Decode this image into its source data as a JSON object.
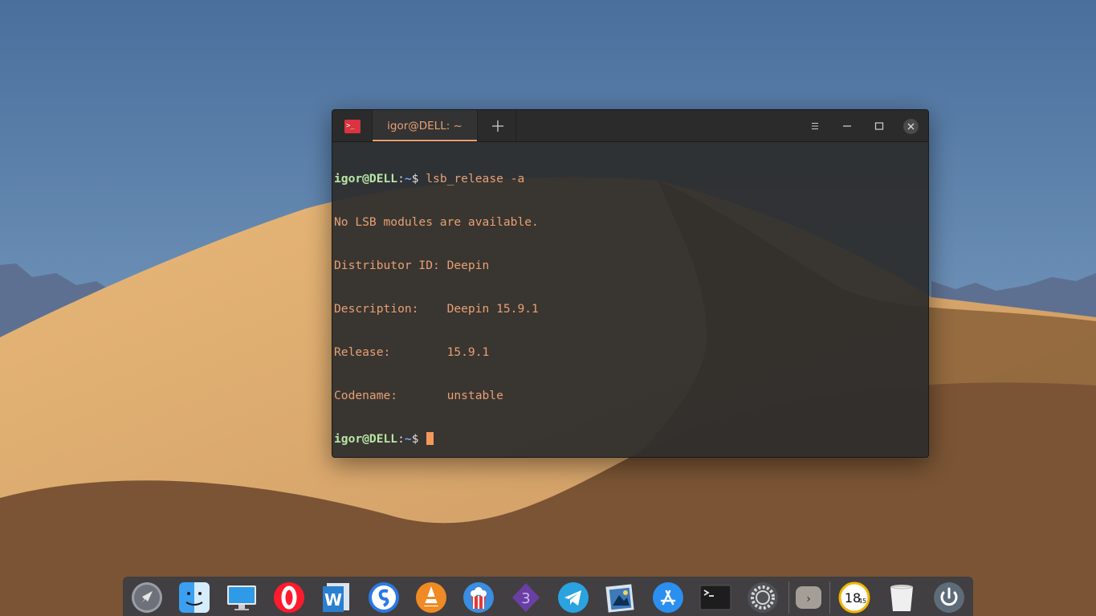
{
  "window": {
    "tab_title": "igor@DELL: ~",
    "app_icon_glyph": ">_"
  },
  "terminal": {
    "prompt": {
      "user": "igor@DELL",
      "colon": ":",
      "dir": "~",
      "dollar": "$"
    },
    "command": " lsb_release -a",
    "output": [
      "No LSB modules are available.",
      "Distributor ID: Deepin",
      "Description:    Deepin 15.9.1",
      "Release:        15.9.1",
      "Codename:       unstable"
    ]
  },
  "dock": {
    "items": [
      {
        "name": "launcher-icon"
      },
      {
        "name": "finder-icon"
      },
      {
        "name": "desktop-icon"
      },
      {
        "name": "opera-icon"
      },
      {
        "name": "wps-writer-icon"
      },
      {
        "name": "sogou-icon"
      },
      {
        "name": "vlc-icon"
      },
      {
        "name": "popcorn-time-icon"
      },
      {
        "name": "vscode-3-icon"
      },
      {
        "name": "telegram-icon"
      },
      {
        "name": "image-viewer-icon"
      },
      {
        "name": "app-store-icon"
      },
      {
        "name": "terminal-icon"
      },
      {
        "name": "settings-icon"
      },
      {
        "name": "expand-arrow-icon"
      },
      {
        "name": "clock-icon"
      },
      {
        "name": "trash-icon"
      },
      {
        "name": "power-icon"
      }
    ],
    "clock_text": "18:45",
    "clock_hour": "18",
    "clock_min": "45",
    "expand_glyph": "›",
    "vscode_glyph": "3",
    "writer_glyph": "W"
  },
  "colors": {
    "accent": "#e8a073",
    "close": "#4a4a4a",
    "terminal_bg": "#2c2c2c"
  }
}
